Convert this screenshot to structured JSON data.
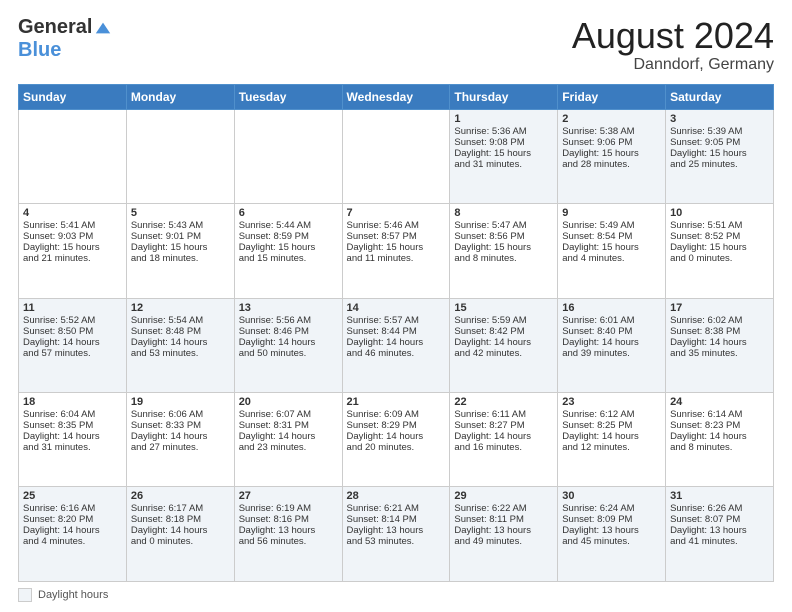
{
  "header": {
    "logo_general": "General",
    "logo_blue": "Blue",
    "month_year": "August 2024",
    "location": "Danndorf, Germany"
  },
  "footer": {
    "daylight_label": "Daylight hours"
  },
  "days_of_week": [
    "Sunday",
    "Monday",
    "Tuesday",
    "Wednesday",
    "Thursday",
    "Friday",
    "Saturday"
  ],
  "weeks": [
    {
      "days": [
        {
          "num": "",
          "info": ""
        },
        {
          "num": "",
          "info": ""
        },
        {
          "num": "",
          "info": ""
        },
        {
          "num": "",
          "info": ""
        },
        {
          "num": "1",
          "info": "Sunrise: 5:36 AM\nSunset: 9:08 PM\nDaylight: 15 hours\nand 31 minutes."
        },
        {
          "num": "2",
          "info": "Sunrise: 5:38 AM\nSunset: 9:06 PM\nDaylight: 15 hours\nand 28 minutes."
        },
        {
          "num": "3",
          "info": "Sunrise: 5:39 AM\nSunset: 9:05 PM\nDaylight: 15 hours\nand 25 minutes."
        }
      ]
    },
    {
      "days": [
        {
          "num": "4",
          "info": "Sunrise: 5:41 AM\nSunset: 9:03 PM\nDaylight: 15 hours\nand 21 minutes."
        },
        {
          "num": "5",
          "info": "Sunrise: 5:43 AM\nSunset: 9:01 PM\nDaylight: 15 hours\nand 18 minutes."
        },
        {
          "num": "6",
          "info": "Sunrise: 5:44 AM\nSunset: 8:59 PM\nDaylight: 15 hours\nand 15 minutes."
        },
        {
          "num": "7",
          "info": "Sunrise: 5:46 AM\nSunset: 8:57 PM\nDaylight: 15 hours\nand 11 minutes."
        },
        {
          "num": "8",
          "info": "Sunrise: 5:47 AM\nSunset: 8:56 PM\nDaylight: 15 hours\nand 8 minutes."
        },
        {
          "num": "9",
          "info": "Sunrise: 5:49 AM\nSunset: 8:54 PM\nDaylight: 15 hours\nand 4 minutes."
        },
        {
          "num": "10",
          "info": "Sunrise: 5:51 AM\nSunset: 8:52 PM\nDaylight: 15 hours\nand 0 minutes."
        }
      ]
    },
    {
      "days": [
        {
          "num": "11",
          "info": "Sunrise: 5:52 AM\nSunset: 8:50 PM\nDaylight: 14 hours\nand 57 minutes."
        },
        {
          "num": "12",
          "info": "Sunrise: 5:54 AM\nSunset: 8:48 PM\nDaylight: 14 hours\nand 53 minutes."
        },
        {
          "num": "13",
          "info": "Sunrise: 5:56 AM\nSunset: 8:46 PM\nDaylight: 14 hours\nand 50 minutes."
        },
        {
          "num": "14",
          "info": "Sunrise: 5:57 AM\nSunset: 8:44 PM\nDaylight: 14 hours\nand 46 minutes."
        },
        {
          "num": "15",
          "info": "Sunrise: 5:59 AM\nSunset: 8:42 PM\nDaylight: 14 hours\nand 42 minutes."
        },
        {
          "num": "16",
          "info": "Sunrise: 6:01 AM\nSunset: 8:40 PM\nDaylight: 14 hours\nand 39 minutes."
        },
        {
          "num": "17",
          "info": "Sunrise: 6:02 AM\nSunset: 8:38 PM\nDaylight: 14 hours\nand 35 minutes."
        }
      ]
    },
    {
      "days": [
        {
          "num": "18",
          "info": "Sunrise: 6:04 AM\nSunset: 8:35 PM\nDaylight: 14 hours\nand 31 minutes."
        },
        {
          "num": "19",
          "info": "Sunrise: 6:06 AM\nSunset: 8:33 PM\nDaylight: 14 hours\nand 27 minutes."
        },
        {
          "num": "20",
          "info": "Sunrise: 6:07 AM\nSunset: 8:31 PM\nDaylight: 14 hours\nand 23 minutes."
        },
        {
          "num": "21",
          "info": "Sunrise: 6:09 AM\nSunset: 8:29 PM\nDaylight: 14 hours\nand 20 minutes."
        },
        {
          "num": "22",
          "info": "Sunrise: 6:11 AM\nSunset: 8:27 PM\nDaylight: 14 hours\nand 16 minutes."
        },
        {
          "num": "23",
          "info": "Sunrise: 6:12 AM\nSunset: 8:25 PM\nDaylight: 14 hours\nand 12 minutes."
        },
        {
          "num": "24",
          "info": "Sunrise: 6:14 AM\nSunset: 8:23 PM\nDaylight: 14 hours\nand 8 minutes."
        }
      ]
    },
    {
      "days": [
        {
          "num": "25",
          "info": "Sunrise: 6:16 AM\nSunset: 8:20 PM\nDaylight: 14 hours\nand 4 minutes."
        },
        {
          "num": "26",
          "info": "Sunrise: 6:17 AM\nSunset: 8:18 PM\nDaylight: 14 hours\nand 0 minutes."
        },
        {
          "num": "27",
          "info": "Sunrise: 6:19 AM\nSunset: 8:16 PM\nDaylight: 13 hours\nand 56 minutes."
        },
        {
          "num": "28",
          "info": "Sunrise: 6:21 AM\nSunset: 8:14 PM\nDaylight: 13 hours\nand 53 minutes."
        },
        {
          "num": "29",
          "info": "Sunrise: 6:22 AM\nSunset: 8:11 PM\nDaylight: 13 hours\nand 49 minutes."
        },
        {
          "num": "30",
          "info": "Sunrise: 6:24 AM\nSunset: 8:09 PM\nDaylight: 13 hours\nand 45 minutes."
        },
        {
          "num": "31",
          "info": "Sunrise: 6:26 AM\nSunset: 8:07 PM\nDaylight: 13 hours\nand 41 minutes."
        }
      ]
    }
  ]
}
